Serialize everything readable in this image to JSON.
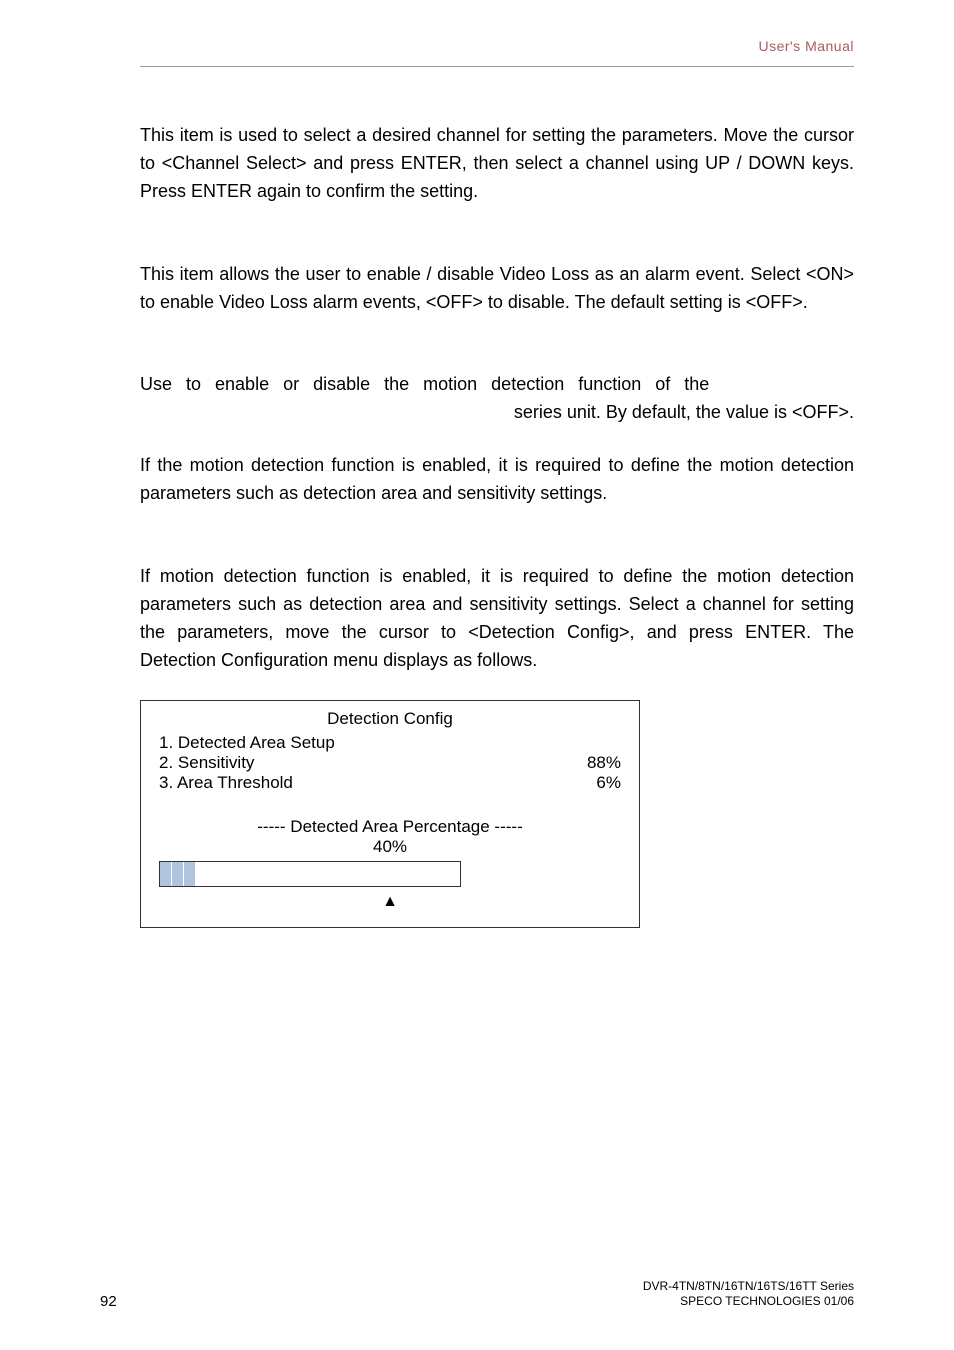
{
  "header": {
    "right_text": "User's  Manual"
  },
  "para1": "This item is used to select a desired channel for setting the parameters. Move the cursor to <Channel Select> and press ENTER, then select a channel using UP / DOWN keys. Press ENTER again to confirm the setting.",
  "para2": "This item allows the user to enable / disable Video Loss as an alarm event. Select <ON> to enable Video Loss alarm events, <OFF> to disable. The default setting is <OFF>.",
  "para3_line1_left": "Use to enable or disable the motion detection function of the",
  "para3_line2_right": "series unit. By default, the value is <OFF>.",
  "para4": "If the motion detection function is enabled, it is required to define the motion detection parameters such as detection area and sensitivity settings.",
  "para5": "If motion detection function is enabled, it is required to define the motion detection parameters such as detection area and sensitivity settings. Select a channel for setting the parameters, move the cursor to <Detection Config>, and press ENTER. The Detection Configuration menu displays as follows.",
  "config_box": {
    "title": "Detection Config",
    "item1": "1. Detected Area Setup",
    "item2_label": "2. Sensitivity",
    "item2_value": "88%",
    "item3_label": "3. Area Threshold",
    "item3_value": "6%",
    "sub_title": "----- Detected Area Percentage -----",
    "percentage": "40%",
    "arrow": "▲"
  },
  "footer": {
    "page_number": "92",
    "line1": "DVR-4TN/8TN/16TN/16TS/16TT Series",
    "line2": "SPECO TECHNOLOGIES 01/06"
  }
}
